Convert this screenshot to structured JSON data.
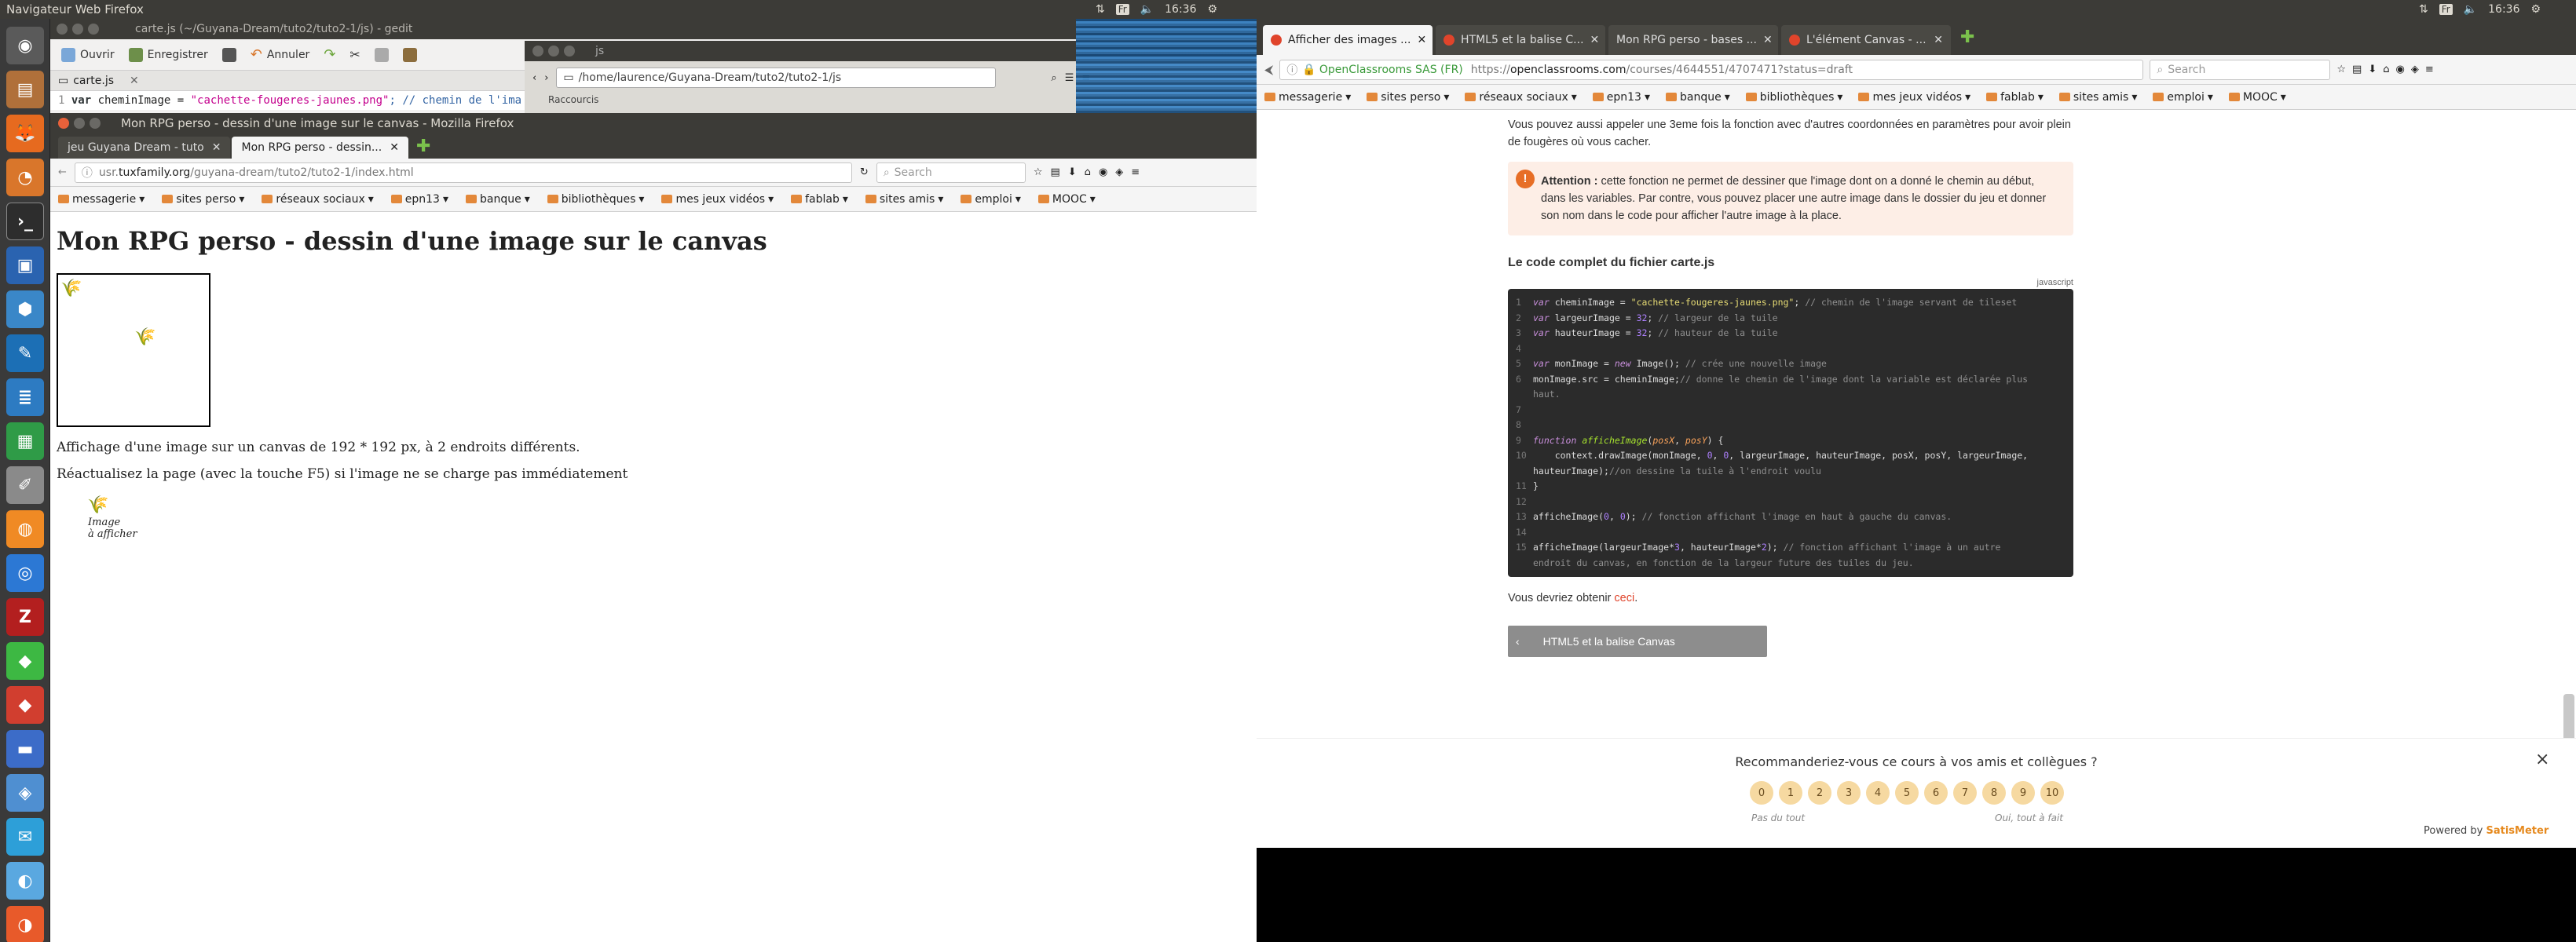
{
  "screen1": {
    "panel": {
      "title": "Navigateur Web Firefox",
      "indicators": [
        "⇅",
        "Fr",
        "🔈",
        "16:36",
        "⚙"
      ]
    },
    "launcher": {
      "icons": [
        "dash-icon",
        "files-icon",
        "firefox-icon",
        "blender-icon",
        "terminal-icon",
        "virtualbox-icon",
        "app-icon",
        "inkscape-icon",
        "writer-icon",
        "calc-icon",
        "text-editor-icon",
        "app-icon",
        "chromium-icon",
        "filezilla-icon",
        "app-icon",
        "app-icon",
        "app-icon",
        "app-icon",
        "app-icon"
      ]
    },
    "gedit": {
      "title": "carte.js (~/Guyana-Dream/tuto2/tuto2-1/js) - gedit",
      "toolbar": {
        "open": "Ouvrir",
        "save": "Enregistrer",
        "undo": "Annuler"
      },
      "tab": "carte.js",
      "code_line_no": "1",
      "code_kw": "var",
      "code_var": " cheminImage = ",
      "code_str": "\"cachette-fougeres-jaunes.png\"",
      "code_rest": "; // chemin de l'ima"
    },
    "nautilus": {
      "title": "js",
      "path": "/home/laurence/Guyana-Dream/tuto2/tuto2-1/js",
      "side_label": "Raccourcis"
    },
    "firefox": {
      "title": "Mon RPG perso - dessin d'une image sur le canvas - Mozilla Firefox",
      "tabs": [
        {
          "label": "jeu Guyana Dream - tuto"
        },
        {
          "label": "Mon RPG perso - dessin..."
        }
      ],
      "url_prefix": "usr.",
      "url_host": "tuxfamily.org",
      "url_path": "/guyana-dream/tuto2/tuto2-1/index.html",
      "search_placeholder": "Search",
      "bookmarks": [
        "messagerie",
        "sites perso",
        "réseaux sociaux",
        "epn13",
        "banque",
        "bibliothèques",
        "mes jeux vidéos",
        "fablab",
        "sites amis",
        "emploi",
        "MOOC"
      ],
      "page": {
        "heading": "Mon RPG perso - dessin d'une image sur le canvas",
        "p1": "Affichage d'une image sur un canvas de 192 * 192 px, à 2 endroits différents.",
        "p2": "Réactualisez la page (avec la touche F5) si l'image ne se charge pas immédiatement",
        "caption1": "Image",
        "caption2": "à afficher"
      }
    }
  },
  "screen2": {
    "panel": {
      "indicators": [
        "⇅",
        "Fr",
        "🔈",
        "16:36",
        "⚙"
      ]
    },
    "tabs": [
      {
        "label": "Afficher des images ..."
      },
      {
        "label": "HTML5 et la balise C..."
      },
      {
        "label": "Mon RPG perso - bases ..."
      },
      {
        "label": "L'élément Canvas - ..."
      }
    ],
    "identity": "OpenClassrooms SAS (FR)",
    "url_prefix": "https://",
    "url_host": "openclassrooms.com",
    "url_path": "/courses/4644551/4707471?status=draft",
    "search_placeholder": "Search",
    "bookmarks": [
      "messagerie",
      "sites perso",
      "réseaux sociaux",
      "epn13",
      "banque",
      "bibliothèques",
      "mes jeux vidéos",
      "fablab",
      "sites amis",
      "emploi",
      "MOOC"
    ],
    "article": {
      "intro": "Vous pouvez aussi appeler une 3eme fois la fonction avec d'autres coordonnées en paramètres pour avoir plein de fougères où vous cacher.",
      "warn_label": "Attention :",
      "warn_text": " cette fonction ne permet de dessiner que l'image dont on a donné le chemin au début, dans les variables. Par contre, vous pouvez placer une autre image dans le dossier du jeu et donner son nom dans le code pour afficher l'autre image à la place.",
      "code_heading": "Le code complet du fichier carte.js",
      "lang": "javascript",
      "result_text": "Vous devriez obtenir ",
      "result_link": "ceci",
      "result_end": ".",
      "prev_label": "HTML5 et la balise Canvas"
    },
    "survey": {
      "question": "Recommanderiez-vous ce cours à vos amis et collègues ?",
      "scale": [
        "0",
        "1",
        "2",
        "3",
        "4",
        "5",
        "6",
        "7",
        "8",
        "9",
        "10"
      ],
      "low": "Pas du tout",
      "high": "Oui, tout à fait",
      "powered": "Powered by ",
      "brand": "SatisMeter",
      "close": "×"
    }
  }
}
